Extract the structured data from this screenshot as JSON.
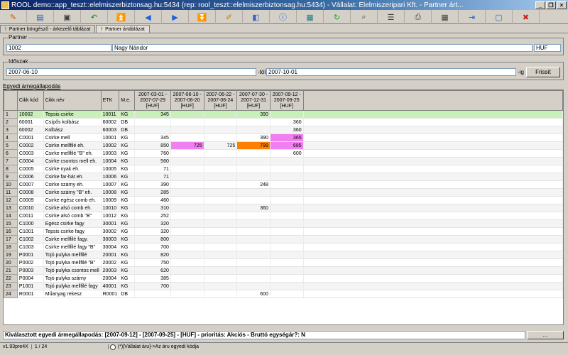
{
  "window": {
    "title": "ROOL demo::app_teszt::elelmiszerbiztonsag.hu:5434 (rep: rool_teszt::elelmiszerbiztonsag.hu:5434) - Vállalat: Élelmiszeripari Kft. - Partner árt..."
  },
  "toolbar": {
    "buttons": [
      {
        "name": "edit-icon",
        "glyph": "✎",
        "color": "#c06000"
      },
      {
        "name": "open-folder-icon",
        "glyph": "▤",
        "color": "#2060c0"
      },
      {
        "name": "save-icon",
        "glyph": "▣",
        "color": "#404040"
      },
      {
        "name": "undo-icon",
        "glyph": "↶",
        "color": "#208020"
      },
      {
        "name": "first-icon",
        "glyph": "⏫",
        "color": "#2060e0"
      },
      {
        "name": "previous-icon",
        "glyph": "◀",
        "color": "#2060e0"
      },
      {
        "name": "next-icon",
        "glyph": "▶",
        "color": "#2060e0"
      },
      {
        "name": "last-icon",
        "glyph": "⏬",
        "color": "#2060e0"
      },
      {
        "name": "edit-record-icon",
        "glyph": "✐",
        "color": "#c08000"
      },
      {
        "name": "delete-icon",
        "glyph": "◧",
        "color": "#4060c0"
      },
      {
        "name": "info-icon",
        "glyph": "ⓘ",
        "color": "#2060c0"
      },
      {
        "name": "report-icon",
        "glyph": "▦",
        "color": "#208080"
      },
      {
        "name": "refresh-icon",
        "glyph": "↻",
        "color": "#20a020"
      },
      {
        "name": "search-icon",
        "glyph": "⌕",
        "color": "#404040"
      },
      {
        "name": "grid-icon",
        "glyph": "☰",
        "color": "#404040"
      },
      {
        "name": "print-icon",
        "glyph": "⎙",
        "color": "#404040"
      },
      {
        "name": "table-icon",
        "glyph": "▦",
        "color": "#404040"
      },
      {
        "name": "export-icon",
        "glyph": "⇥",
        "color": "#2060c0"
      },
      {
        "name": "window-icon",
        "glyph": "▢",
        "color": "#2060c0"
      },
      {
        "name": "close-icon",
        "glyph": "✖",
        "color": "#d02020"
      }
    ]
  },
  "tabs": [
    {
      "label": "Partner böngésző - árkezelő táblázat",
      "active": false
    },
    {
      "label": "Partner ártáblázat",
      "active": true
    }
  ],
  "partner": {
    "group_label": "Partner",
    "code": "1002",
    "name": "Nagy Nándor",
    "currency": "HUF"
  },
  "period": {
    "group_label": "Időszak",
    "from": "2007-06-10",
    "to_label": "-tól",
    "to": "2007-10-01",
    "until_label": "-ig",
    "refresh_label": "Frissít"
  },
  "grid": {
    "section_title": "Egyedi árnegállapodás",
    "headers": [
      "Cikk kód",
      "Cikk név",
      "ETK",
      "M.e."
    ],
    "period_headers": [
      "2007-03-01 - 2007-07-29 [HUF]",
      "2007-06-10 - 2007-06-20 [HUF]",
      "2007-06-22 - 2007-06-24 [HUF]",
      "2007-07-30 - 2007-12-31 [HUF]",
      "2007-09-12 - 2007-09-25 [HUF]"
    ],
    "rows": [
      {
        "n": "1",
        "code": "10002",
        "name": "Tepsis csirke",
        "etk": "10011",
        "me": "KG",
        "p": [
          "345",
          "",
          "",
          "390",
          ""
        ]
      },
      {
        "n": "2",
        "code": "60001",
        "name": "Csípős kolbász",
        "etk": "60002",
        "me": "DB",
        "p": [
          "",
          "",
          "",
          "",
          "360"
        ]
      },
      {
        "n": "3",
        "code": "60002",
        "name": "Kolbász",
        "etk": "60003",
        "me": "DB",
        "p": [
          "",
          "",
          "",
          "",
          "360"
        ]
      },
      {
        "n": "4",
        "code": "C0001",
        "name": "Csirke mell",
        "etk": "10001",
        "me": "KG",
        "p": [
          "345",
          "",
          "",
          "390",
          "365"
        ]
      },
      {
        "n": "5",
        "code": "C0002",
        "name": "Csirke mellfilé eh.",
        "etk": "10002",
        "me": "KG",
        "p": [
          "850",
          "725",
          "725",
          "799",
          "685"
        ]
      },
      {
        "n": "6",
        "code": "C0003",
        "name": "Csirke mellfilé \"B\" eh.",
        "etk": "10003",
        "me": "KG",
        "p": [
          "760",
          "",
          "",
          "",
          "600"
        ]
      },
      {
        "n": "7",
        "code": "C0004",
        "name": "Csirke csontos mell eh.",
        "etk": "10004",
        "me": "KG",
        "p": [
          "560",
          "",
          "",
          "",
          ""
        ]
      },
      {
        "n": "8",
        "code": "C0005",
        "name": "Csirke nyak eh.",
        "etk": "10005",
        "me": "KG",
        "p": [
          "71",
          "",
          "",
          "",
          ""
        ]
      },
      {
        "n": "9",
        "code": "C0006",
        "name": "Csirke far-hát eh.",
        "etk": "10006",
        "me": "KG",
        "p": [
          "71",
          "",
          "",
          "",
          ""
        ]
      },
      {
        "n": "10",
        "code": "C0007",
        "name": "Csirke szárny eh.",
        "etk": "10007",
        "me": "KG",
        "p": [
          "390",
          "",
          "",
          "248",
          ""
        ]
      },
      {
        "n": "11",
        "code": "C0008",
        "name": "Csirke szárny \"B\" eh.",
        "etk": "10008",
        "me": "KG",
        "p": [
          "285",
          "",
          "",
          "",
          ""
        ]
      },
      {
        "n": "12",
        "code": "C0009",
        "name": "Csirke egész comb eh.",
        "etk": "10009",
        "me": "KG",
        "p": [
          "460",
          "",
          "",
          "",
          ""
        ]
      },
      {
        "n": "13",
        "code": "C0010",
        "name": "Csirke alsó comb eh.",
        "etk": "10010",
        "me": "KG",
        "p": [
          "310",
          "",
          "",
          "360",
          ""
        ]
      },
      {
        "n": "14",
        "code": "C0011",
        "name": "Csirke alsó comb \"B\"",
        "etk": "10012",
        "me": "KG",
        "p": [
          "252",
          "",
          "",
          "",
          ""
        ]
      },
      {
        "n": "15",
        "code": "C1000",
        "name": "Egész csirke fagy",
        "etk": "30001",
        "me": "KG",
        "p": [
          "320",
          "",
          "",
          "",
          ""
        ]
      },
      {
        "n": "16",
        "code": "C1001",
        "name": "Tepsis csirke fagy",
        "etk": "30002",
        "me": "KG",
        "p": [
          "320",
          "",
          "",
          "",
          ""
        ]
      },
      {
        "n": "17",
        "code": "C1002",
        "name": "Csirke mellfilé fagy.",
        "etk": "30003",
        "me": "KG",
        "p": [
          "800",
          "",
          "",
          "",
          ""
        ]
      },
      {
        "n": "18",
        "code": "C1003",
        "name": "Csirke mellfilé fagy \"B\"",
        "etk": "30004",
        "me": "KG",
        "p": [
          "700",
          "",
          "",
          "",
          ""
        ]
      },
      {
        "n": "19",
        "code": "P0001",
        "name": "Tojó pulyka mellfilé",
        "etk": "20001",
        "me": "KG",
        "p": [
          "820",
          "",
          "",
          "",
          ""
        ]
      },
      {
        "n": "20",
        "code": "P0002",
        "name": "Tojó pulyka mellfilé \"B\"",
        "etk": "20002",
        "me": "KG",
        "p": [
          "750",
          "",
          "",
          "",
          ""
        ]
      },
      {
        "n": "21",
        "code": "P0003",
        "name": "Tojó pulyka csontos mell",
        "etk": "20003",
        "me": "KG",
        "p": [
          "620",
          "",
          "",
          "",
          ""
        ]
      },
      {
        "n": "22",
        "code": "P0004",
        "name": "Tojó pulyka szárny",
        "etk": "20004",
        "me": "KG",
        "p": [
          "385",
          "",
          "",
          "",
          ""
        ]
      },
      {
        "n": "23",
        "code": "P1001",
        "name": "Tojó pulyka mellfilé fagy",
        "etk": "40001",
        "me": "KG",
        "p": [
          "700",
          "",
          "",
          "",
          ""
        ]
      },
      {
        "n": "24",
        "code": "R0001",
        "name": "Műanyag rekesz",
        "etk": "R0001",
        "me": "DB",
        "p": [
          "",
          "",
          "",
          "600",
          ""
        ]
      }
    ],
    "highlights": [
      {
        "row": 3,
        "col": 4,
        "color": "#f080f0"
      },
      {
        "row": 4,
        "col": 1,
        "color": "#f080f0"
      },
      {
        "row": 4,
        "col": 3,
        "color": "#ff8000"
      },
      {
        "row": 4,
        "col": 4,
        "color": "#f080f0"
      }
    ],
    "selected_row_color": "#c8f0b8"
  },
  "status": {
    "text": "Kiválasztott egyedi ármegállapodás: [2007-09-12] - [2007-09-25] - [HUF] - prioritás: Akciós - Bruttó egységár?: N",
    "button_label": "..."
  },
  "bottombar": {
    "version": "v1.93pre4X",
    "position": "1 / 24",
    "radio_label": "(*)[Vállalat áru]->Az áru egyedi kódja"
  }
}
